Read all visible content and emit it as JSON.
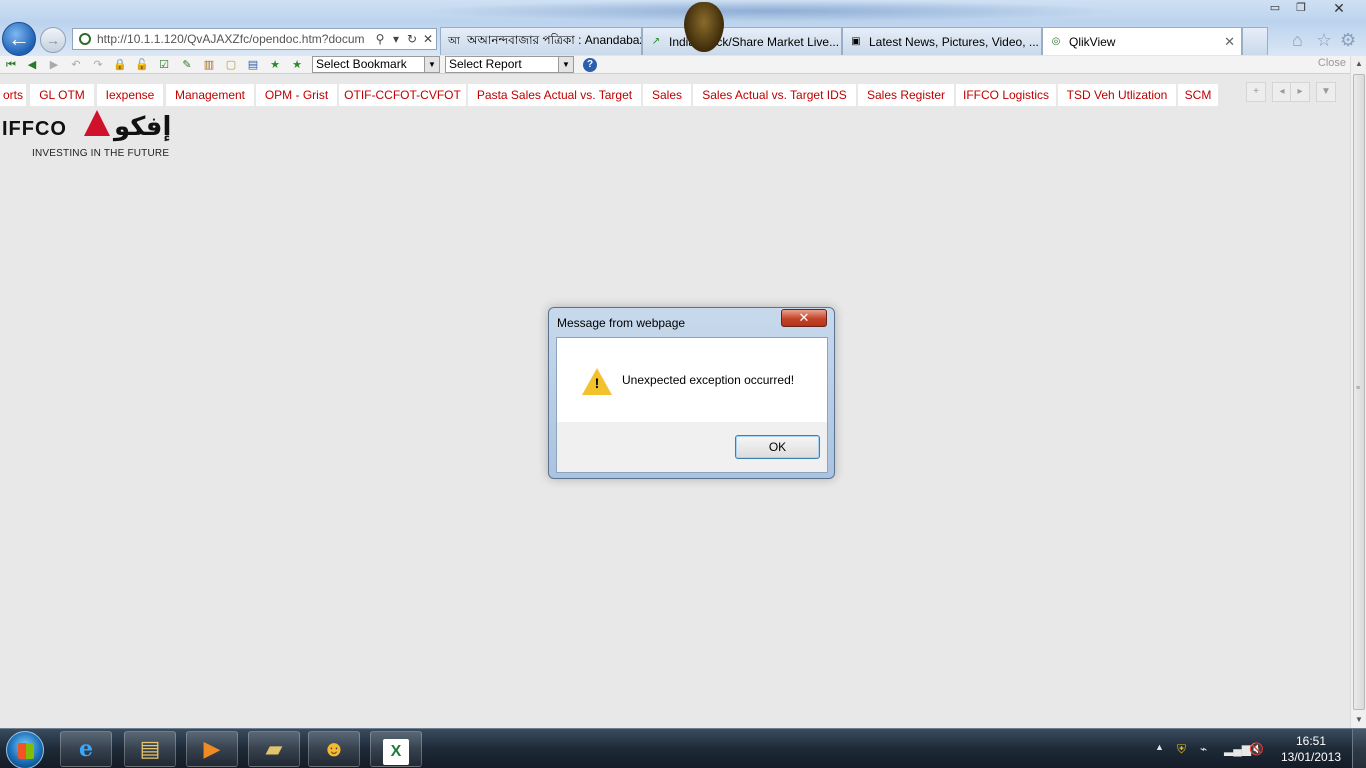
{
  "browser": {
    "window_buttons": {
      "minimize": "▭",
      "maximize": "❐",
      "close": "✕"
    },
    "address": {
      "url": "http://10.1.1.120/QvAJAXZfc/opendoc.htm?docum"
    },
    "tabs": [
      {
        "label": "অআনন্দবাজার পত্রিকা : Anandabazar P...",
        "favicon": "আ"
      },
      {
        "label": "India Stock/Share Market Live...",
        "favicon": "↗"
      },
      {
        "label": "Latest News, Pictures, Video, ...",
        "favicon": "▣"
      },
      {
        "label": "QlikView",
        "favicon": "◎"
      }
    ],
    "tab_close": "✕"
  },
  "qv_toolbar": {
    "bookmark_select": "Select Bookmark",
    "report_select": "Select Report",
    "help": "?",
    "close_label": "Close"
  },
  "sheet_tabs": [
    "orts",
    "GL OTM",
    "Iexpense",
    "Management",
    "OPM - Grist",
    "OTIF-CCFOT-CVFOT",
    "Pasta Sales Actual vs. Target",
    "Sales",
    "Sales Actual vs. Target IDS",
    "Sales Register",
    "IFFCO Logistics",
    "TSD Veh Utlization",
    "SCM"
  ],
  "sheet_nav": {
    "add": "+",
    "prev": "◂",
    "next": "▸",
    "menu": "▼"
  },
  "logo": {
    "text": "IFFCO",
    "arabic": "إفكو",
    "tagline": "INVESTING IN THE FUTURE"
  },
  "dialog": {
    "title": "Message from webpage",
    "message": "Unexpected exception occurred!",
    "ok_label": "OK",
    "close_glyph": "✕"
  },
  "taskbar": {
    "time": "16:51",
    "date": "13/01/2013"
  },
  "colors": {
    "sheet_tab_text": "#c00000",
    "dialog_frame": "#aac3df",
    "taskbar": "#1e2a38",
    "logo_mark": "#d0112b"
  },
  "icons": [
    "back-arrow-icon",
    "forward-arrow-icon",
    "search-icon",
    "refresh-icon",
    "stop-icon",
    "home-icon",
    "favorites-star-icon",
    "gear-icon",
    "warning-icon",
    "windows-start-icon",
    "internet-explorer-icon",
    "file-explorer-icon",
    "media-player-icon",
    "excel-icon"
  ]
}
